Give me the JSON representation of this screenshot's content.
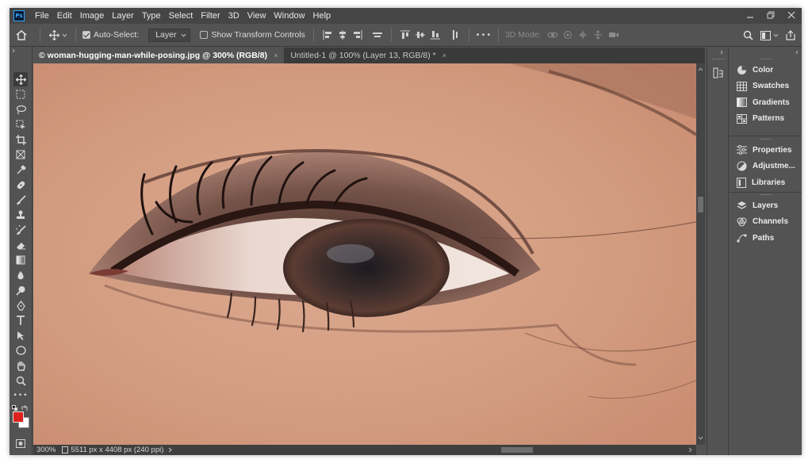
{
  "app": {
    "logo_text": "Ps"
  },
  "menu": [
    "File",
    "Edit",
    "Image",
    "Layer",
    "Type",
    "Select",
    "Filter",
    "3D",
    "View",
    "Window",
    "Help"
  ],
  "options_bar": {
    "auto_select_label": "Auto-Select:",
    "auto_select_checked": true,
    "layer_dropdown": "Layer",
    "show_transform_label": "Show Transform Controls",
    "show_transform_checked": false,
    "more_label": "•••",
    "mode_3d_label": "3D Mode:"
  },
  "tabs": [
    {
      "label": "© woman-hugging-man-while-posing.jpg @ 300% (RGB/8)",
      "active": true
    },
    {
      "label": "Untitled-1 @ 100% (Layer 13, RGB/8) *",
      "active": false
    }
  ],
  "tab_close_glyph": "×",
  "status": {
    "zoom": "300%",
    "doc_info": "5511 px x 4408 px (240 ppi)"
  },
  "colors": {
    "foreground": "#e0201c",
    "background": "#ffffff",
    "accent": "#31a8ff"
  },
  "tools": [
    "move-icon",
    "marquee-icon",
    "lasso-icon",
    "object-select-icon",
    "crop-icon",
    "frame-icon",
    "eyedropper-icon",
    "healing-brush-icon",
    "brush-icon",
    "clone-stamp-icon",
    "history-brush-icon",
    "eraser-icon",
    "gradient-icon",
    "blur-icon",
    "dodge-icon",
    "pen-icon",
    "type-icon",
    "path-select-icon",
    "ellipse-icon",
    "hand-icon",
    "zoom-icon",
    "more-tools-icon"
  ],
  "panels": {
    "group1": [
      "Color",
      "Swatches",
      "Gradients",
      "Patterns"
    ],
    "group2": [
      "Properties",
      "Adjustme...",
      "Libraries"
    ],
    "group3": [
      "Layers",
      "Channels",
      "Paths"
    ]
  }
}
